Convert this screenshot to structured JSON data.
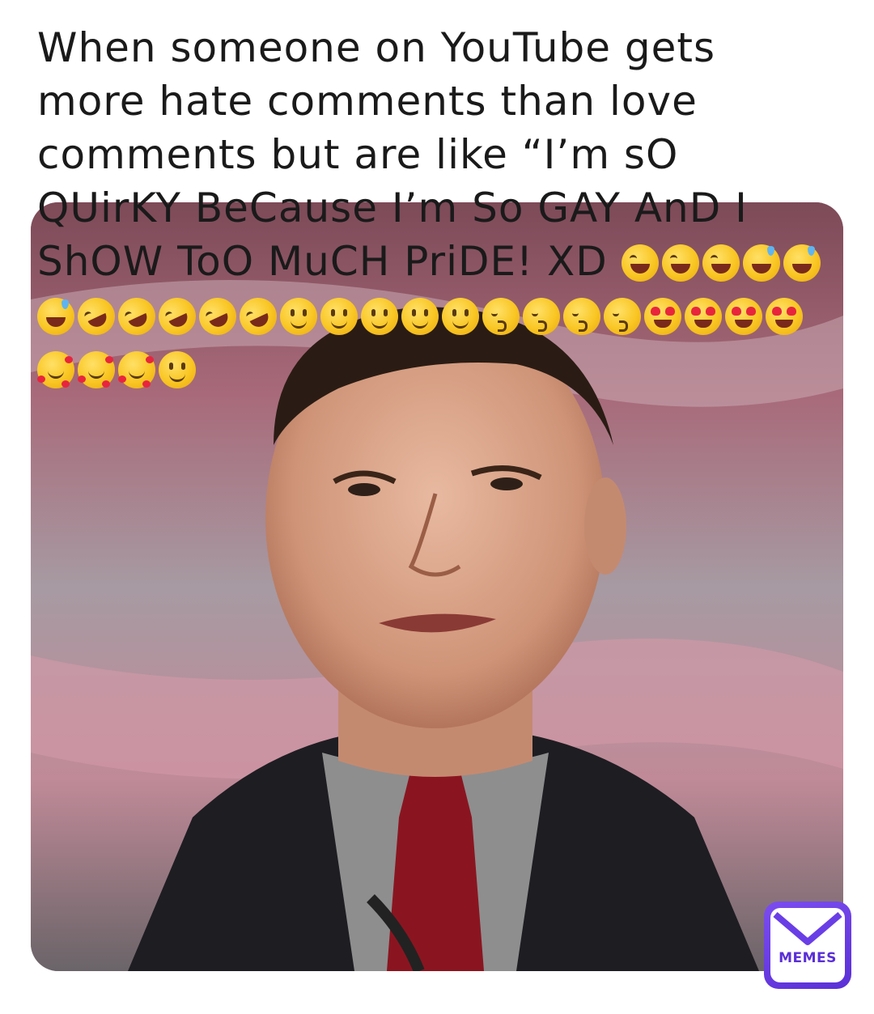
{
  "caption": {
    "line_text": "When someone on YouTube gets more hate comments than love comments but are like “I’m sO QUirKY BeCause I’m So GAY AnD I ShOW ToO MuCH PriDE! XD",
    "emojis": [
      "joy",
      "joy",
      "joy",
      "sweat",
      "sweat",
      "sweat",
      "rofl",
      "rofl",
      "rofl",
      "rofl",
      "rofl",
      "smile",
      "smile",
      "smile",
      "smile",
      "smile",
      "kiss",
      "kiss",
      "kiss",
      "kiss",
      "hearts",
      "hearts",
      "hearts",
      "hearts",
      "love",
      "love",
      "love",
      "smile"
    ]
  },
  "photo": {
    "subject": "man-squinting-in-suit-and-red-tie",
    "background_colors": [
      "#b06a7a",
      "#9a9aa2",
      "#6e6e76"
    ]
  },
  "logo": {
    "text": "MEMES",
    "color": "#5a2fd6"
  }
}
